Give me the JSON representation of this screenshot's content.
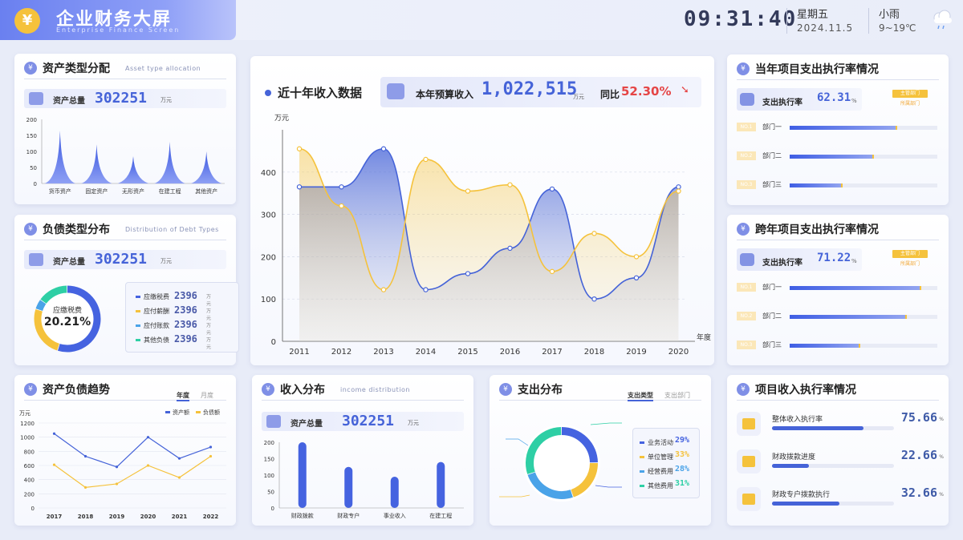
{
  "header": {
    "logo_glyph": "¥",
    "title": "企业财务大屏",
    "subtitle": "Enterprise Finance Screen",
    "time": "09:31:40",
    "weekday": "星期五",
    "date": "2024.11.5",
    "weather": "小雨",
    "temp": "9~19℃",
    "weather_icon": "cloud-rain-icon"
  },
  "asset_type": {
    "title": "资产类型分配",
    "subtitle": "Asset type allocation",
    "summary_label": "资产总量",
    "summary_value": "302251",
    "summary_unit": "万元",
    "chart_data": {
      "type": "area",
      "categories": [
        "货币资产",
        "固定资产",
        "无形资产",
        "在建工程",
        "其他资产"
      ],
      "values": [
        165,
        122,
        85,
        130,
        100
      ],
      "ylim": [
        0,
        200
      ],
      "yticks": [
        0,
        50,
        100,
        150,
        200
      ]
    }
  },
  "debt_type": {
    "title": "负债类型分布",
    "subtitle": "Distribution of Debt Types",
    "summary_label": "资产总量",
    "summary_value": "302251",
    "summary_unit": "万元",
    "center_label": "应缴税费",
    "center_value": "20.21%",
    "chart_data": {
      "type": "pie",
      "labels": [
        "应缴税费",
        "应付薪酬",
        "应付账款",
        "其他负债"
      ],
      "values": [
        2396,
        2396,
        2396,
        2396
      ],
      "unit": "万元",
      "colors": [
        "#4563e0",
        "#f5c23c",
        "#4aa3e8",
        "#2ecfa5"
      ]
    }
  },
  "trend": {
    "title": "资产负债趋势",
    "tabs": [
      "年度",
      "月度"
    ],
    "unit": "万元",
    "chart_data": {
      "type": "line",
      "categories": [
        "2017",
        "2018",
        "2019",
        "2020",
        "2021",
        "2022"
      ],
      "series": [
        {
          "name": "资产额",
          "values": [
            1050,
            730,
            580,
            1000,
            700,
            860
          ],
          "color": "#4563d8"
        },
        {
          "name": "负债额",
          "values": [
            610,
            290,
            340,
            600,
            430,
            730
          ],
          "color": "#f5c23c"
        }
      ],
      "ylim": [
        0,
        1200
      ],
      "yticks": [
        0,
        200,
        400,
        600,
        800,
        1000,
        1200
      ]
    }
  },
  "income": {
    "title": "近十年收入数据",
    "budget_label": "本年预算收入",
    "budget_value": "1,022,515",
    "budget_unit": "万元",
    "yoy_label": "同比",
    "yoy_value": "52.30%",
    "ylabel": "万元",
    "xlabel": "年度",
    "chart_data": {
      "type": "area",
      "categories": [
        "2011",
        "2012",
        "2013",
        "2014",
        "2015",
        "2016",
        "2017",
        "2018",
        "2019",
        "2020"
      ],
      "series": [
        {
          "name": "blue",
          "values": [
            365,
            365,
            455,
            122,
            160,
            220,
            360,
            100,
            150,
            365
          ],
          "color": "#4563d8"
        },
        {
          "name": "yellow",
          "values": [
            455,
            320,
            122,
            430,
            355,
            370,
            165,
            255,
            200,
            355
          ],
          "color": "#f5c23c"
        }
      ],
      "ylim": [
        0,
        500
      ],
      "yticks": [
        0,
        100,
        200,
        300,
        400
      ]
    }
  },
  "income_dist": {
    "title": "收入分布",
    "subtitle": "income distribution",
    "summary_label": "资产总量",
    "summary_value": "302251",
    "summary_unit": "万元",
    "chart_data": {
      "type": "bar",
      "categories": [
        "财政拨款",
        "财政专户",
        "事业收入",
        "在建工程"
      ],
      "values": [
        200,
        125,
        95,
        140
      ],
      "ylim": [
        0,
        200
      ],
      "yticks": [
        0,
        50,
        100,
        150,
        200
      ]
    }
  },
  "expense_dist": {
    "title": "支出分布",
    "tabs": [
      "支出类型",
      "支出部门"
    ],
    "chart_data": {
      "type": "pie",
      "labels": [
        "业务活动",
        "单位管理",
        "经营费用",
        "其他费用"
      ],
      "values": [
        29,
        33,
        28,
        31
      ],
      "display": [
        "29%",
        "33%",
        "28%",
        "31%"
      ],
      "colors": [
        "#4563e0",
        "#f5c23c",
        "#4aa3e8",
        "#2ecfa5"
      ]
    }
  },
  "annual_exec": {
    "title": "当年项目支出执行率情况",
    "rate_label": "支出执行率",
    "rate_value": "62.31",
    "rate_unit": "%",
    "badge": "主管部门",
    "badge2": "所属部门",
    "rows": [
      {
        "no": "NO.1",
        "name": "部门一",
        "pct": 0.72
      },
      {
        "no": "NO.2",
        "name": "部门二",
        "pct": 0.56
      },
      {
        "no": "NO.3",
        "name": "部门三",
        "pct": 0.35
      }
    ]
  },
  "cross_exec": {
    "title": "跨年项目支出执行率情况",
    "rate_label": "支出执行率",
    "rate_value": "71.22",
    "rate_unit": "%",
    "badge": "主管部门",
    "badge2": "所属部门",
    "rows": [
      {
        "no": "NO.1",
        "name": "部门一",
        "pct": 0.88
      },
      {
        "no": "NO.2",
        "name": "部门二",
        "pct": 0.78
      },
      {
        "no": "NO.3",
        "name": "部门三",
        "pct": 0.47
      }
    ]
  },
  "project_income": {
    "title": "项目收入执行率情况",
    "rows": [
      {
        "label": "整体收入执行率",
        "value": "75.66",
        "unit": "%",
        "pct": 0.75
      },
      {
        "label": "财政拨款进度",
        "value": "22.66",
        "unit": "%",
        "pct": 0.3
      },
      {
        "label": "财政专户拨款执行",
        "value": "32.66",
        "unit": "%",
        "pct": 0.55
      }
    ]
  }
}
